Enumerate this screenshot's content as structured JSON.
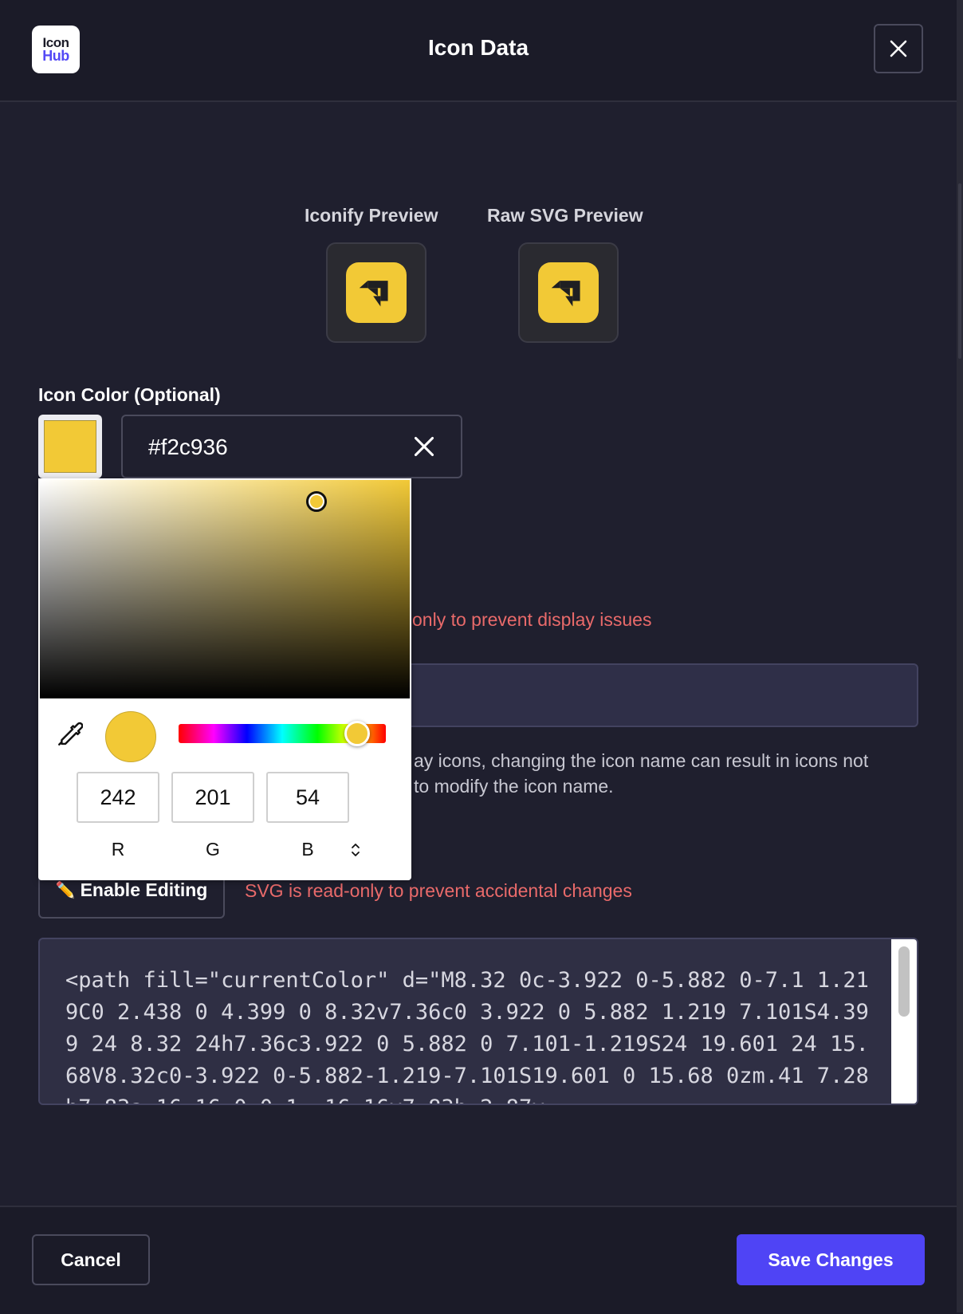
{
  "header": {
    "logo_line1": "Icon",
    "logo_line2": "Hub",
    "title": "Icon Data"
  },
  "previews": {
    "iconify_label": "Iconify Preview",
    "raw_label": "Raw SVG Preview"
  },
  "color": {
    "label": "Icon Color (Optional)",
    "hex_value": "#f2c936",
    "picker": {
      "r": "242",
      "g": "201",
      "b": "54",
      "r_label": "R",
      "g_label": "G",
      "b_label": "B"
    }
  },
  "notices": {
    "name_readonly": "only to prevent display issues",
    "name_hint_line1": "ay icons, changing the icon name can result in icons not",
    "name_hint_line2": "to modify the icon name.",
    "svg_readonly": "SVG is read-only to prevent accidental changes"
  },
  "svg_section": {
    "enable_editing": "Enable Editing",
    "code": "<path fill=\"currentColor\" d=\"M8.32 0c-3.922 0-5.882 0-7.1 1.219C0 2.438 0 4.399 0 8.32v7.36c0 3.922 0 5.882 1.219 7.101S4.399 24 8.32 24h7.36c3.922 0 5.882 0 7.101-1.219S24 19.601 24 15.68V8.32c0-3.922 0-5.882-1.219-7.101S19.601 0 15.68 0zm.41 7.28h7.83a.16.16 0 0 1 .16.16v7.83h-2.87v"
  },
  "footer": {
    "cancel": "Cancel",
    "save": "Save Changes"
  },
  "colors": {
    "accent": "#4f44f5",
    "icon_color": "#f2c936",
    "warning": "#e96a6a",
    "background": "#1f1f2e"
  }
}
